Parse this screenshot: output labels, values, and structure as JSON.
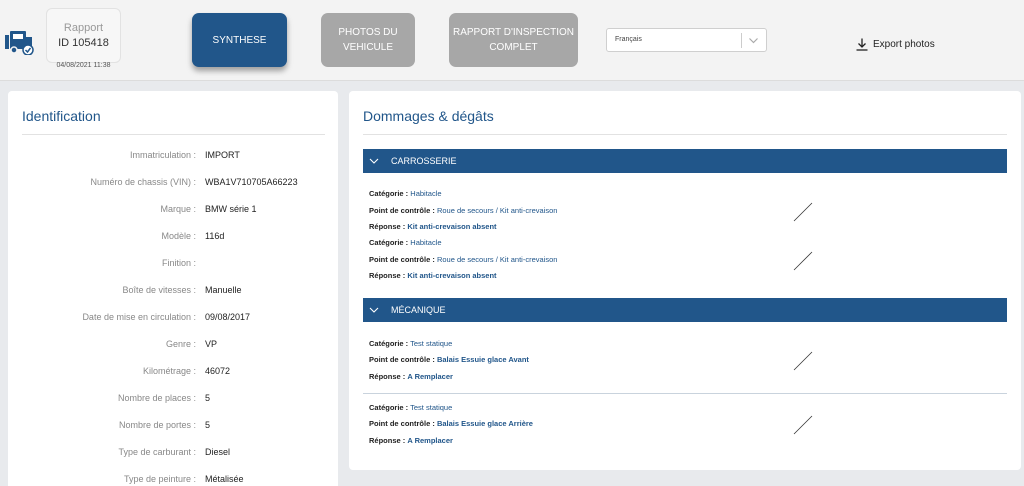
{
  "header": {
    "report_label": "Rapport",
    "report_id": "ID 105418",
    "report_date": "04/08/2021 11:38",
    "tabs": [
      {
        "line1": "SYNTHESE",
        "line2": ""
      },
      {
        "line1": "PHOTOS DU",
        "line2": "VEHICULE"
      },
      {
        "line1": "RAPPORT D'INSPECTION",
        "line2": "COMPLET"
      }
    ],
    "language": "Français",
    "export_label": "Export photos"
  },
  "identification": {
    "title": "Identification",
    "rows": [
      {
        "label": "Immatriculation :",
        "value": "IMPORT"
      },
      {
        "label": "Numéro de chassis (VIN) :",
        "value": "WBA1V710705A66223"
      },
      {
        "label": "Marque :",
        "value": "BMW série 1"
      },
      {
        "label": "Modèle :",
        "value": "116d"
      },
      {
        "label": "Finition :",
        "value": ""
      },
      {
        "label": "Boîte de vitesses :",
        "value": "Manuelle"
      },
      {
        "label": "Date de mise en circulation :",
        "value": "09/08/2017"
      },
      {
        "label": "Genre :",
        "value": "VP"
      },
      {
        "label": "Kilométrage :",
        "value": "46072"
      },
      {
        "label": "Nombre de places :",
        "value": "5"
      },
      {
        "label": "Nombre de portes :",
        "value": "5"
      },
      {
        "label": "Type de carburant :",
        "value": "Diesel"
      },
      {
        "label": "Type de peinture :",
        "value": "Métalisée"
      }
    ]
  },
  "damages": {
    "title": "Dommages & dégâts",
    "labels": {
      "category": "Catégorie :",
      "checkpoint": "Point de contrôle :",
      "response": "Réponse :"
    },
    "sections": [
      {
        "name": "CARROSSERIE",
        "items": [
          {
            "category": "Habitacle",
            "checkpoint": "Roue de secours / Kit anti-crevaison",
            "response": "Kit anti-crevaison absent"
          },
          {
            "category": "Habitacle",
            "checkpoint": "Roue de secours / Kit anti-crevaison",
            "response": "Kit anti-crevaison absent"
          }
        ]
      },
      {
        "name": "MÉCANIQUE",
        "items": [
          {
            "category": "Test statique",
            "checkpoint": "Balais Essuie glace Avant",
            "response": "A Remplacer"
          },
          {
            "category": "Test statique",
            "checkpoint": "Balais Essuie glace Arrière",
            "response": "A Remplacer"
          }
        ]
      }
    ]
  },
  "colors": {
    "brand": "#21568a",
    "tab_inactive": "#a7a7a7",
    "background": "#e8eaed"
  }
}
